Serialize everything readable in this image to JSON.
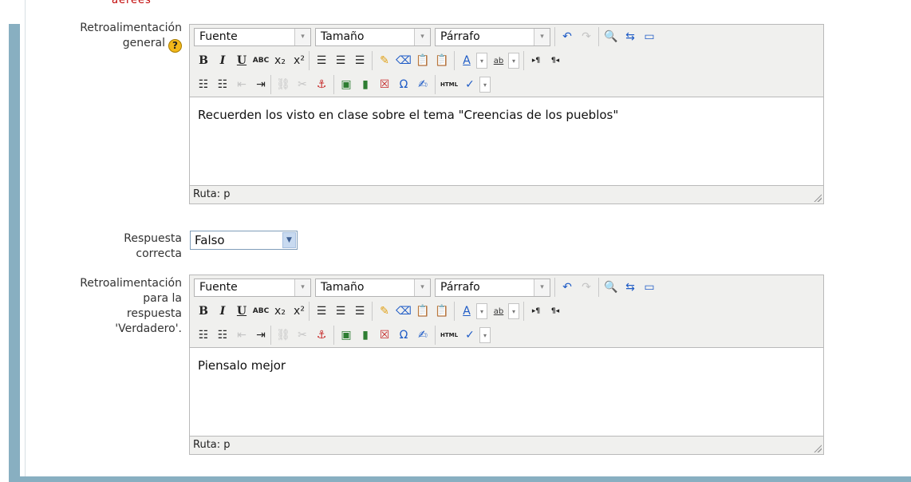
{
  "top_cut_text": "aerees",
  "section1": {
    "label": "Retroalimentación general",
    "label_line1": "Retroalimentación",
    "label_line2": "general",
    "help_icon": "help-icon",
    "toolbar": {
      "font_select": "Fuente",
      "size_select": "Tamaño",
      "format_select": "Párrafo"
    },
    "content": "Recuerden los visto en clase sobre el tema \"Creencias de los pueblos\"",
    "path": "Ruta: p"
  },
  "correct_answer": {
    "label_line1": "Respuesta",
    "label_line2": "correcta",
    "value": "Falso"
  },
  "section2": {
    "label_line1": "Retroalimentación",
    "label_line2": "para la",
    "label_line3": "respuesta",
    "label_line4": "'Verdadero'.",
    "toolbar": {
      "font_select": "Fuente",
      "size_select": "Tamaño",
      "format_select": "Párrafo"
    },
    "content": "Piensalo mejor",
    "path": "Ruta: p"
  },
  "toolbar_glyphs": {
    "bold": "B",
    "italic": "I",
    "underline": "U",
    "strike": "ABC",
    "sub": "x₂",
    "sup": "x²",
    "html": "HTML"
  },
  "colors": {
    "accent_bar": "#88afc1",
    "toolbar_bg": "#f0f0ee"
  }
}
